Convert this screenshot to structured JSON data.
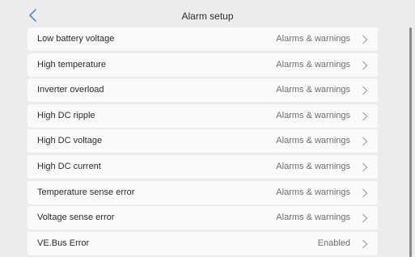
{
  "header": {
    "title": "Alarm setup",
    "back_icon": "chevron-left-icon"
  },
  "colors": {
    "accent": "#4a8fe0",
    "background": "#ececec",
    "row": "#fafafa"
  },
  "rows": [
    {
      "label": "Low battery voltage",
      "value": "Alarms & warnings"
    },
    {
      "label": "High temperature",
      "value": "Alarms & warnings"
    },
    {
      "label": "Inverter overload",
      "value": "Alarms & warnings"
    },
    {
      "label": "High DC ripple",
      "value": "Alarms & warnings"
    },
    {
      "label": "High DC voltage",
      "value": "Alarms & warnings"
    },
    {
      "label": "High DC current",
      "value": "Alarms & warnings"
    },
    {
      "label": "Temperature sense error",
      "value": "Alarms & warnings"
    },
    {
      "label": "Voltage sense error",
      "value": "Alarms & warnings"
    },
    {
      "label": "VE.Bus Error",
      "value": "Enabled"
    }
  ],
  "row_icon": "chevron-right-icon"
}
